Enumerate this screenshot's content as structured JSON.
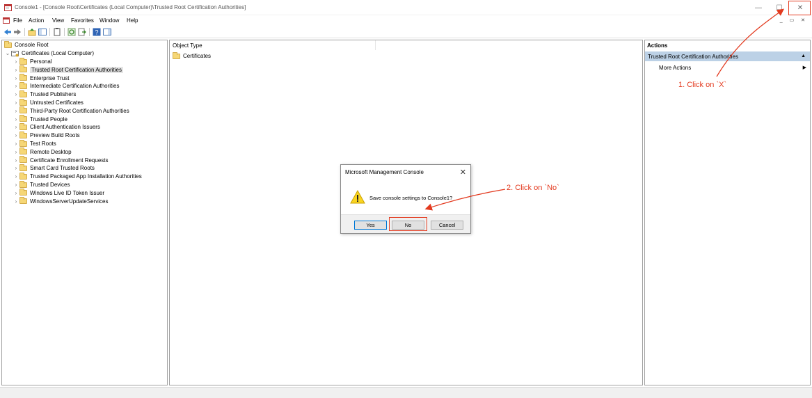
{
  "window": {
    "title": "Console1 - [Console Root\\Certificates (Local Computer)\\Trusted Root Certification Authorities]",
    "minimize_glyph": "—",
    "maximize_glyph": "☐",
    "close_glyph": "✕"
  },
  "menu": {
    "items": [
      "File",
      "Action",
      "View",
      "Favorites",
      "Window",
      "Help"
    ],
    "mdi_controls": "_ ▭ ✕"
  },
  "toolbar": {
    "icons": [
      "back-arrow-icon",
      "forward-arrow-icon",
      "up-folder-icon",
      "show-hide-tree-icon",
      "properties-icon",
      "refresh-icon",
      "export-list-icon",
      "help-icon",
      "show-action-pane-icon"
    ]
  },
  "tree": {
    "root": "Console Root",
    "certificates": "Certificates (Local Computer)",
    "items": [
      "Personal",
      "Trusted Root Certification Authorities",
      "Enterprise Trust",
      "Intermediate Certification Authorities",
      "Trusted Publishers",
      "Untrusted Certificates",
      "Third-Party Root Certification Authorities",
      "Trusted People",
      "Client Authentication Issuers",
      "Preview Build Roots",
      "Test Roots",
      "Remote Desktop",
      "Certificate Enrollment Requests",
      "Smart Card Trusted Roots",
      "Trusted Packaged App Installation Authorities",
      "Trusted Devices",
      "Windows Live ID Token Issuer",
      "WindowsServerUpdateServices"
    ],
    "selected_index": 1
  },
  "center": {
    "column_header": "Object Type",
    "rows": [
      "Certificates"
    ]
  },
  "actions": {
    "header": "Actions",
    "group": "Trusted Root Certification Authorities",
    "more": "More Actions"
  },
  "dialog": {
    "title": "Microsoft Management Console",
    "close": "✕",
    "message": "Save console settings to Console1?",
    "yes": "Yes",
    "no": "No",
    "cancel": "Cancel"
  },
  "annotations": {
    "step1": "1. Click on `X`",
    "step2": "2. Click on `No`",
    "color": "#e33a1f"
  }
}
